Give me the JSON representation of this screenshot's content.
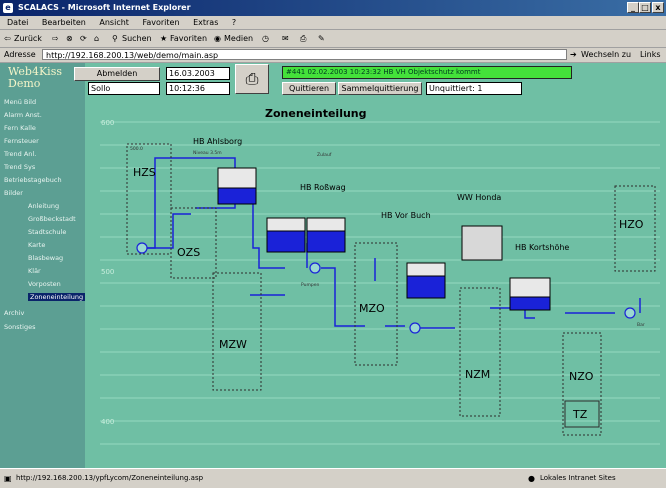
{
  "window": {
    "title": "SCALACS - Microsoft Internet Explorer",
    "min": "_",
    "max": "□",
    "close": "x"
  },
  "menu": [
    "Datei",
    "Bearbeiten",
    "Ansicht",
    "Favoriten",
    "Extras",
    "?"
  ],
  "toolbar": {
    "back": "Zurück",
    "search": "Suchen",
    "favorites": "Favoriten",
    "media": "Medien"
  },
  "address": {
    "label": "Adresse",
    "url": "http://192.168.200.13/web/demo/main.asp",
    "go": "Wechseln zu",
    "links": "Links"
  },
  "sidebar": {
    "logo_line1": "Web4Kiss",
    "logo_line2": "Demo",
    "items": [
      "Menü Bild",
      "Alarm Anst.",
      "Fern Kalle",
      "Fernsteuer",
      "Trend Anl.",
      "Trend Sys",
      "Betriebstagebuch",
      "Bilder",
      "Anleitung",
      "Großbeckstadt",
      "Stadtschule",
      "Karte",
      "Blasbewag",
      "Klär",
      "Vorposten",
      "Zoneneinteilung",
      "Archiv",
      "Sonstiges"
    ]
  },
  "header": {
    "ack_button": "Abmelden",
    "date": "16.03.2003",
    "user": "Sollo",
    "time": "10:12:36",
    "alarm_text": "#441 02.02.2003 10:23:32 HB VH Objektschutz kommt",
    "quit_button": "Quittieren",
    "group_quit_button": "Sammelquittierung",
    "unquit": "Unquittiert: 1"
  },
  "diagram": {
    "title": "Zoneneinteilung",
    "y_labels": [
      "600",
      "500",
      "400"
    ],
    "zones": [
      "HZS",
      "OZS",
      "MZW",
      "MZO",
      "NZM",
      "NZO",
      "TZ",
      "HZO"
    ],
    "tanks": [
      "HB Ahlsborg",
      "HB Roßwag",
      "HB Vor Buch",
      "WW Honda",
      "HB Kortshöhe"
    ],
    "small": [
      "500.0",
      "Niveau 3.5m",
      "Zulauf",
      "Pumpen",
      "Bar"
    ]
  },
  "status": {
    "url": "http://192.168.200.13/ypfLycom/Zoneneinteilung.asp",
    "zone": "Lokales Intranet Sites"
  },
  "colors": {
    "alarm": "#44e13a",
    "panel": "#6fbfa4",
    "sidebar": "#5c9f93",
    "water": "#1a22d8"
  }
}
